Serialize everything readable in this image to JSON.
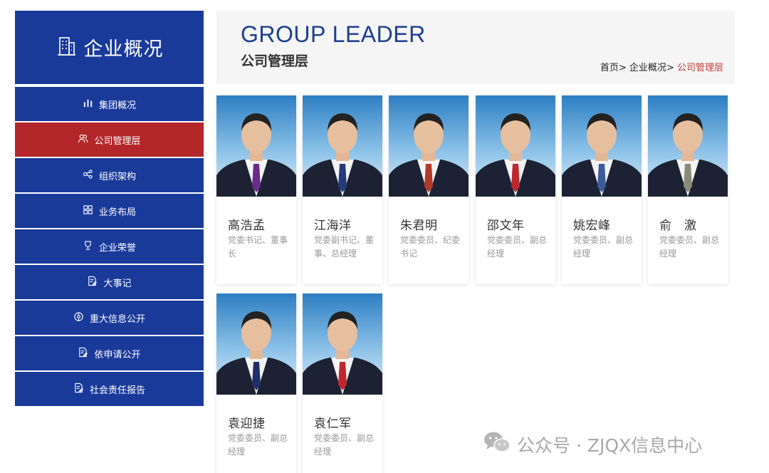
{
  "sidebar": {
    "title": "企业概况",
    "icon": "building-icon",
    "items": [
      {
        "label": "集团概况",
        "icon": "bar-chart-icon",
        "active": false
      },
      {
        "label": "公司管理层",
        "icon": "users-icon",
        "active": true
      },
      {
        "label": "组织架构",
        "icon": "org-structure-icon",
        "active": false
      },
      {
        "label": "业务布局",
        "icon": "grid-icon",
        "active": false
      },
      {
        "label": "企业荣誉",
        "icon": "trophy-icon",
        "active": false
      },
      {
        "label": "大事记",
        "icon": "document-edit-icon",
        "active": false
      },
      {
        "label": "重大信息公开",
        "icon": "info-circle-icon",
        "active": false
      },
      {
        "label": "依申请公开",
        "icon": "document-edit-icon",
        "active": false
      },
      {
        "label": "社会责任报告",
        "icon": "document-edit-icon",
        "active": false
      }
    ]
  },
  "header": {
    "en_title": "GROUP LEADER",
    "cn_title": "公司管理层",
    "breadcrumb": {
      "home": "首页",
      "section": "企业概况",
      "current": "公司管理层",
      "separator": ">"
    }
  },
  "leaders": [
    {
      "name": "高浩孟",
      "role": "党委书记、董事长",
      "tie_color": "#6a2a8a"
    },
    {
      "name": "江海洋",
      "role": "党委副书记、董事、总经理",
      "tie_color": "#253a7a"
    },
    {
      "name": "朱君明",
      "role": "党委委员、纪委书记",
      "tie_color": "#b03a2a"
    },
    {
      "name": "邵文年",
      "role": "党委委员、副总经理",
      "tie_color": "#c0272d"
    },
    {
      "name": "姚宏峰",
      "role": "党委委员、副总经理",
      "tie_color": "#3a5a9a"
    },
    {
      "name": "俞　激",
      "role": "党委委员、副总经理",
      "tie_color": "#8a8a7a"
    },
    {
      "name": "袁迎捷",
      "role": "党委委员、副总经理",
      "tie_color": "#1f2f6a"
    },
    {
      "name": "袁仁军",
      "role": "党委委员、副总经理",
      "tie_color": "#c0272d"
    }
  ],
  "watermark": {
    "text": "公众号 · ZJQX信息中心",
    "icon": "wechat-icon"
  },
  "colors": {
    "nav_blue": "#1a3a9a",
    "active_red": "#b3262a",
    "title_blue": "#1d3f8f",
    "breadcrumb_current": "#c23a3a"
  }
}
